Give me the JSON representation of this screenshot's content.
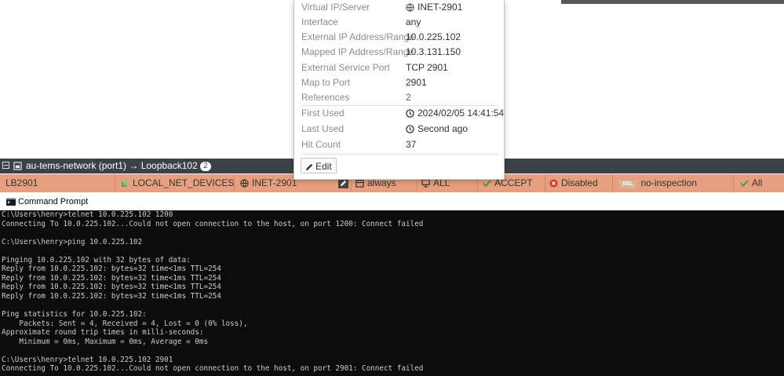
{
  "popup": {
    "rows": [
      {
        "label": "Virtual IP/Server",
        "value": "INET-2901"
      },
      {
        "label": "Interface",
        "value": "any"
      },
      {
        "label": "External IP Address/Range",
        "value": "10.0.225.102"
      },
      {
        "label": "Mapped IP Address/Range",
        "value": "10.3.131.150"
      },
      {
        "label": "External Service Port",
        "value": "TCP 2901"
      },
      {
        "label": "Map to Port",
        "value": "2901"
      },
      {
        "label": "References",
        "value": "2"
      },
      {
        "label": "First Used",
        "value": "2024/02/05 14:41:54"
      },
      {
        "label": "Last Used",
        "value": "Second ago"
      },
      {
        "label": "Hit Count",
        "value": "37"
      }
    ],
    "edit_label": "Edit"
  },
  "group_header": {
    "title": "au-tems-network (port1) → Loopback102",
    "count": "2"
  },
  "policy": {
    "name": "LB2901",
    "source": "LOCAL_NET_DEVICES",
    "destination": "INET-2901",
    "schedule": "always",
    "service": "ALL",
    "action": "ACCEPT",
    "nat": "Disabled",
    "ssl_badge": "SSL",
    "security_profile": "no-inspection",
    "log": "All"
  },
  "console": {
    "window_title": "Command Prompt",
    "lines": [
      "C:\\Users\\henry>telnet 10.0.225.102 1200",
      "Connecting To 10.0.225.102...Could not open connection to the host, on port 1200: Connect failed",
      "",
      "C:\\Users\\henry>ping 10.0.225.102",
      "",
      "Pinging 10.0.225.102 with 32 bytes of data:",
      "Reply from 10.0.225.102: bytes=32 time<1ms TTL=254",
      "Reply from 10.0.225.102: bytes=32 time<1ms TTL=254",
      "Reply from 10.0.225.102: bytes=32 time<1ms TTL=254",
      "Reply from 10.0.225.102: bytes=32 time<1ms TTL=254",
      "",
      "Ping statistics for 10.0.225.102:",
      "    Packets: Sent = 4, Received = 4, Lost = 0 (0% loss),",
      "Approximate round trip times in milli-seconds:",
      "    Minimum = 0ms, Maximum = 0ms, Average = 0ms",
      "",
      "C:\\Users\\henry>telnet 10.0.225.102 2901",
      "Connecting To 10.0.225.102...Could not open connection to the host, on port 2901: Connect failed"
    ]
  },
  "colors": {
    "policy_row": "#e6a07f",
    "group_header": "#3c4148",
    "console_bg": "#0c0c0c",
    "link": "#2a6fb0",
    "accept_green": "#3aa03a",
    "disabled_red": "#d9362a"
  }
}
